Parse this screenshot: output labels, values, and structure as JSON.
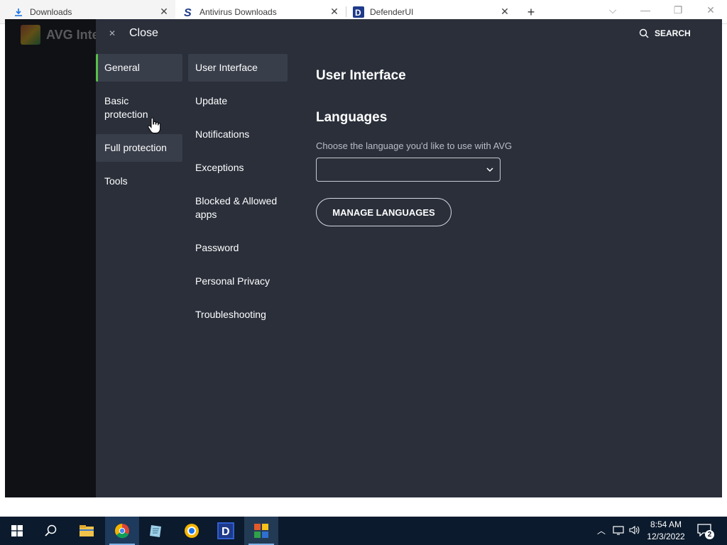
{
  "browser": {
    "tabs": [
      {
        "title": "Downloads",
        "icon": "download-icon",
        "active": true
      },
      {
        "title": "Antivirus Downloads",
        "icon": "s-logo-icon",
        "active": false
      },
      {
        "title": "DefenderUI",
        "icon": "d-logo-icon",
        "active": false
      }
    ],
    "new_tab_icon": "plus-icon"
  },
  "app": {
    "background_logo_text": "AVG Inte",
    "close_label": "Close",
    "search_label": "SEARCH",
    "nav": [
      {
        "label": "General",
        "selected": true
      },
      {
        "label": "Basic protection",
        "selected": false
      },
      {
        "label": "Full protection",
        "selected": false,
        "hover": true
      },
      {
        "label": "Tools",
        "selected": false
      }
    ],
    "subnav": [
      {
        "label": "User Interface",
        "selected": true
      },
      {
        "label": "Update"
      },
      {
        "label": "Notifications"
      },
      {
        "label": "Exceptions"
      },
      {
        "label": "Blocked & Allowed apps"
      },
      {
        "label": "Password"
      },
      {
        "label": "Personal Privacy"
      },
      {
        "label": "Troubleshooting"
      }
    ],
    "content": {
      "title": "User Interface",
      "section_title": "Languages",
      "description": "Choose the language you'd like to use with AVG",
      "language_select_value": "",
      "manage_button": "MANAGE LANGUAGES"
    },
    "colors": {
      "panel": "#2a2f3a",
      "selected_item": "#383e4a",
      "accent": "#5bbf4a"
    }
  },
  "taskbar": {
    "items": [
      "windows-start-icon",
      "search-icon",
      "file-explorer-icon",
      "chrome-icon",
      "notepad-icon",
      "browser-icon",
      "defenderui-icon",
      "avg-icon"
    ],
    "time": "8:54 AM",
    "date": "12/3/2022",
    "notification_count": "2"
  }
}
